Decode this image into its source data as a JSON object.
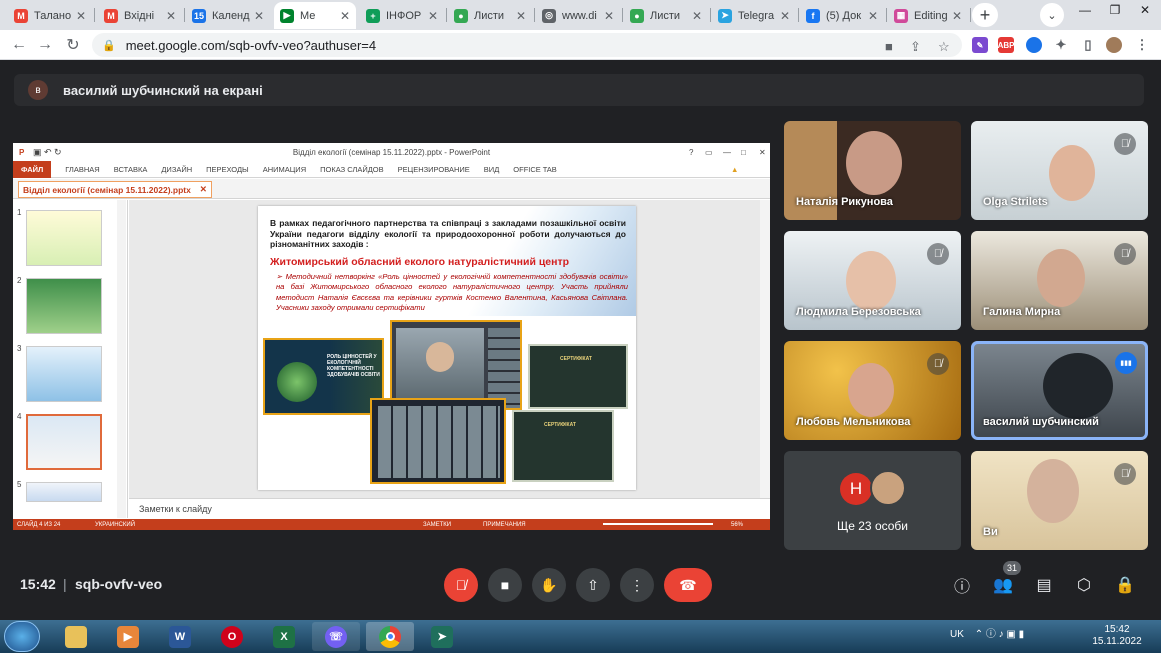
{
  "browser": {
    "tabs": [
      {
        "label": "Талано",
        "icon": "gmail-icon",
        "color": "#ea4335",
        "glyph": "M"
      },
      {
        "label": "Вхідні",
        "icon": "gmail-icon",
        "color": "#ea4335",
        "glyph": "M"
      },
      {
        "label": "Календ",
        "icon": "calendar-icon",
        "color": "#1a73e8",
        "glyph": "15"
      },
      {
        "label": "Ме",
        "icon": "meet-icon",
        "color": "#00832d",
        "glyph": "▶"
      },
      {
        "label": "ІНФОР",
        "icon": "sheets-icon",
        "color": "#0f9d58",
        "glyph": "+"
      },
      {
        "label": "Листи",
        "icon": "pin-icon",
        "color": "#34a853",
        "glyph": "●"
      },
      {
        "label": "www.di",
        "icon": "globe-icon",
        "color": "#5f6368",
        "glyph": "◎"
      },
      {
        "label": "Листи",
        "icon": "leaf-icon",
        "color": "#34a853",
        "glyph": "●"
      },
      {
        "label": "Telegra",
        "icon": "telegram-icon",
        "color": "#2aa3e0",
        "glyph": "➤"
      },
      {
        "label": "(5) Док",
        "icon": "facebook-icon",
        "color": "#1877f2",
        "glyph": "f"
      },
      {
        "label": "Editing",
        "icon": "editor-icon",
        "color": "#d04a9a",
        "glyph": "▦"
      }
    ],
    "new_tab": "+",
    "url": "meet.google.com/sqb-ovfv-veo?authuser=4"
  },
  "banner": {
    "avatar_letter": "в",
    "text": "василий шубчинский на екрані"
  },
  "ppt": {
    "window_title": "Відділ екології (семінар 15.11.2022).pptx - PowerPoint",
    "help": "?",
    "ribbon_file": "ФАЙЛ",
    "ribbon": [
      "ГЛАВНАЯ",
      "ВСТАВКА",
      "ДИЗАЙН",
      "ПЕРЕХОДЫ",
      "АНИМАЦИЯ",
      "ПОКАЗ СЛАЙДОВ",
      "РЕЦЕНЗИРОВАНИЕ",
      "ВИД",
      "OFFICE TAB"
    ],
    "doc_tab": "Відділ екології (семінар 15.11.2022).pptx",
    "thumb_numbers": [
      "1",
      "2",
      "3",
      "4",
      "5"
    ],
    "selected_slide": 4,
    "slide": {
      "paragraph": "В рамках педагогічного партнерства та співпраці з закладами позашкільної освіти України педагоги відділу екології та природоохоронної роботи долучаються до різноманітних заходів :",
      "heading": "Житомирський обласний еколого натуралістичний центр",
      "bullet": "Методичний нетворкінг «Роль цінностей у екологічній компетентності здобувачів освіти» на базі Житомирського обласного еколого натуралістичного центру. Участь прийняли методист Наталія Євсєєва та керівники гуртків Костенко Валентина, Касьянова Світлана. Учасники заходу отримали сертифікати",
      "card_text": "РОЛЬ ЦІННОСТЕЙ У ЕКОЛОГІЧНІЙ КОМПЕТЕНТНОСТІ ЗДОБУВАЧІВ ОСВІТИ",
      "cert_label": "СЕРТИФІКАТ"
    },
    "notes_placeholder": "Заметки к слайду",
    "status": {
      "slide_info": "СЛАЙД 4 ИЗ 24",
      "language": "УКРАИНСКИЙ",
      "notes": "ЗАМЕТКИ",
      "comments": "ПРИМЕЧАНИЯ",
      "zoom": "56%"
    }
  },
  "participants": [
    {
      "name": "Наталія Рикунова",
      "muted": false
    },
    {
      "name": "Olga Strilets",
      "muted": true
    },
    {
      "name": "Людмила Березовська",
      "muted": true
    },
    {
      "name": "Галина Мирна",
      "muted": true
    },
    {
      "name": "Любовь Мельникова",
      "muted": true
    },
    {
      "name": "василий шубчинский",
      "muted": false,
      "speaking": true
    },
    {
      "name": "Ви",
      "muted": true
    }
  ],
  "more_tile": {
    "avatar_letter": "Н",
    "label": "Ще 23 особи"
  },
  "meet_bar": {
    "time": "15:42",
    "separator": "|",
    "meeting_code": "sqb-ovfv-veo",
    "participant_count": "31"
  },
  "taskbar": {
    "lang": "UK",
    "time": "15:42",
    "date": "15.11.2022"
  }
}
